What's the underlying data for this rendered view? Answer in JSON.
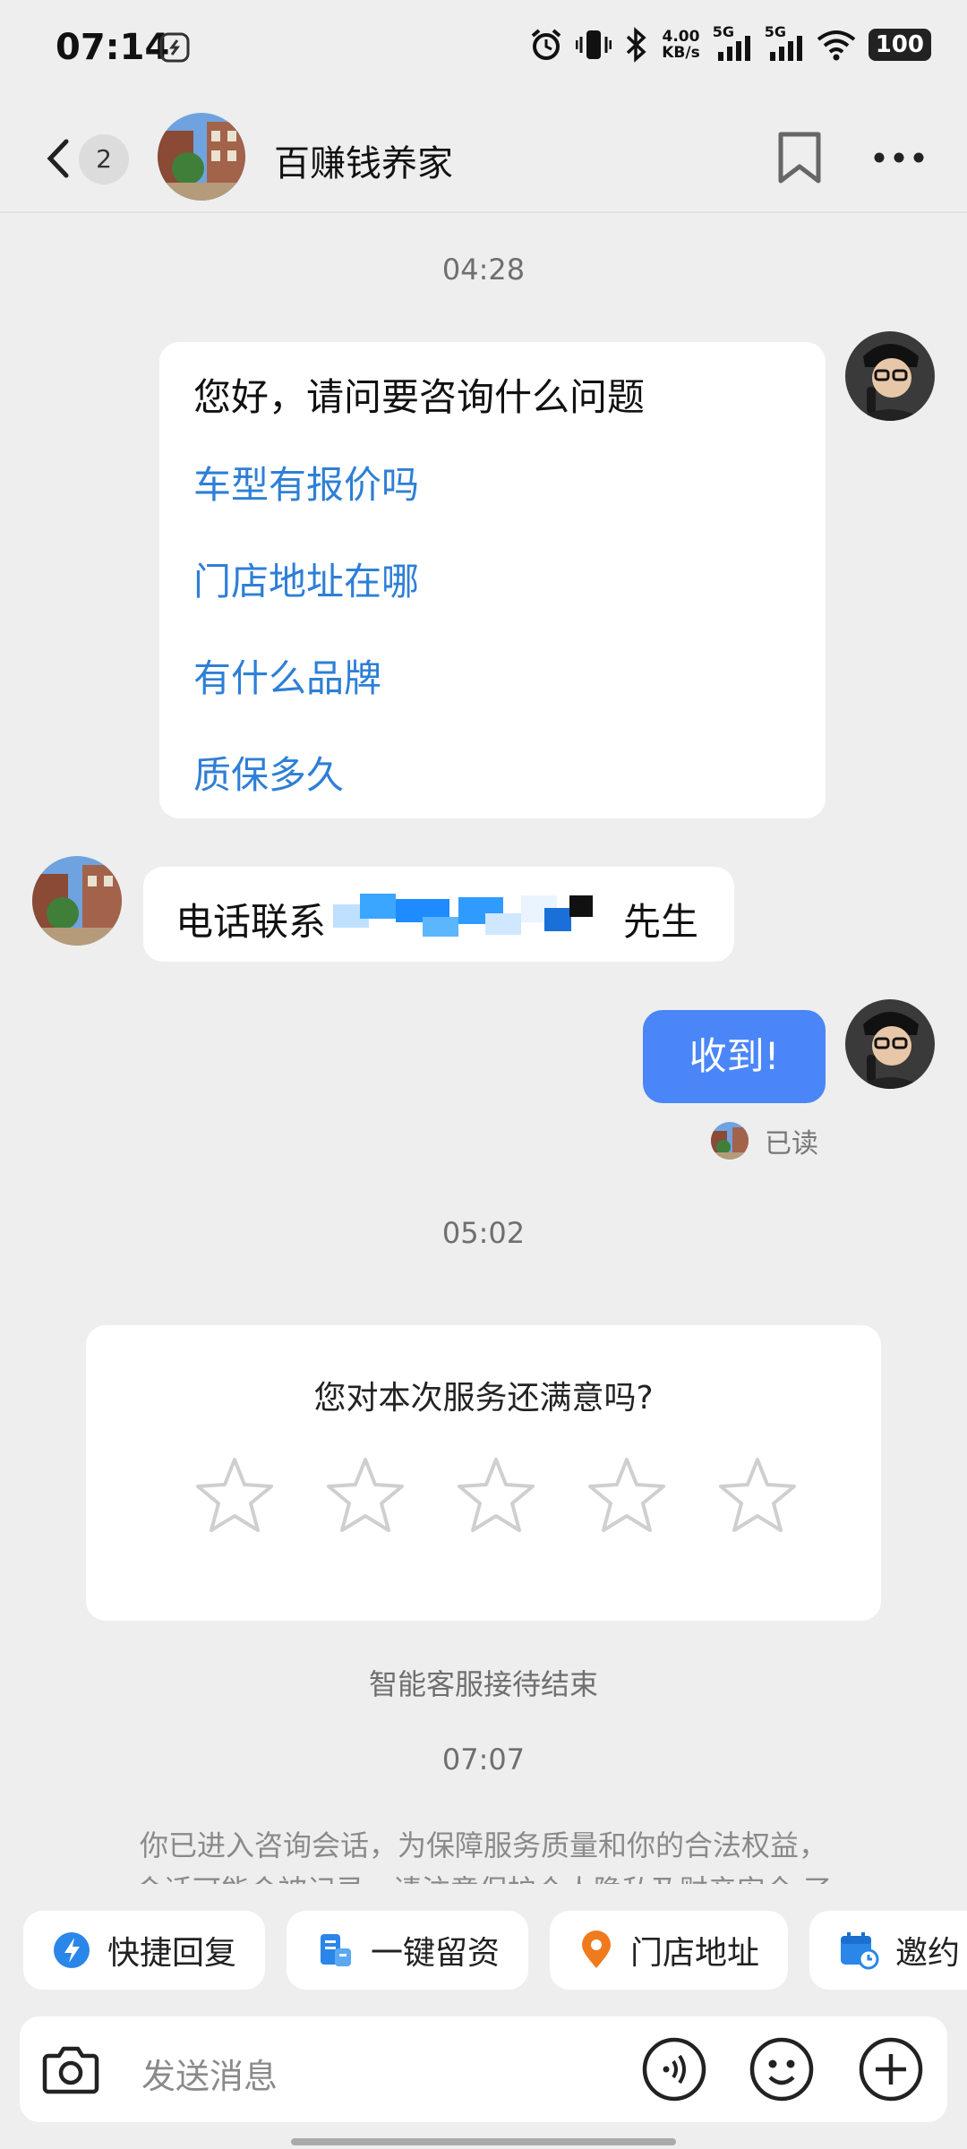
{
  "status_bar": {
    "time": "07:14",
    "speed_value": "4.00",
    "speed_unit": "KB/s",
    "net1": "5G",
    "net2": "5G",
    "battery": "100"
  },
  "header": {
    "back_count": "2",
    "shop_name": "百赚钱养家"
  },
  "chat": {
    "time1": "04:28",
    "greeting": "您好，请问要咨询什么问题",
    "quick_questions": [
      "车型有报价吗",
      "门店地址在哪",
      "有什么品牌",
      "质保多久"
    ],
    "phone_prefix": "电话联系",
    "phone_suffix": "先生",
    "reply": "收到!",
    "read_status": "已读",
    "time2": "05:02",
    "rating_question": "您对本次服务还满意吗?",
    "rating_value": 0,
    "rating_max": 5,
    "end_text": "智能客服接待结束",
    "time3": "07:07",
    "notice_line1": "你已进入咨询会话，为保障服务质量和你的合法权益，",
    "notice_line2": "会话可能会被记录，请注意保护个人隐私及财产安全 了"
  },
  "quick_actions": [
    {
      "label": "快捷回复",
      "icon": "lightning-icon"
    },
    {
      "label": "一键留资",
      "icon": "form-icon"
    },
    {
      "label": "门店地址",
      "icon": "location-pin-icon"
    },
    {
      "label": "邀约",
      "icon": "calendar-icon"
    }
  ],
  "input": {
    "placeholder": "发送消息"
  },
  "colors": {
    "accent_blue": "#4a86f7",
    "link_blue": "#2e7fd6",
    "background": "#eeeeee"
  }
}
